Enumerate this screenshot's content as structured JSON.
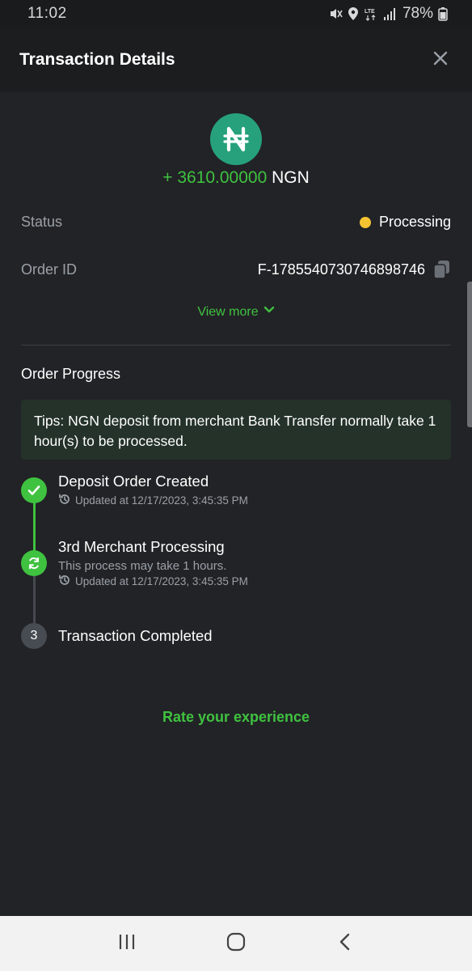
{
  "status_bar": {
    "time": "11:02",
    "battery": "78%"
  },
  "header": {
    "title": "Transaction Details"
  },
  "currency": {
    "icon": "naira-icon",
    "symbol": "₦",
    "amount": "+ 3610.00000",
    "code": "NGN",
    "brand_color": "#26a17b"
  },
  "details": {
    "status_label": "Status",
    "status_value": "Processing",
    "status_color": "#f5c431",
    "order_label": "Order ID",
    "order_value": "F-1785540730746898746",
    "view_more": "View more"
  },
  "progress": {
    "title": "Order Progress",
    "tips": "Tips: NGN deposit from merchant Bank Transfer normally take 1 hour(s) to be processed.",
    "steps": [
      {
        "title": "Deposit Order Created",
        "updated": "Updated at 12/17/2023, 3:45:35 PM",
        "state": "done"
      },
      {
        "title": "3rd Merchant Processing",
        "subtitle": "This process may take 1 hours.",
        "updated": "Updated at 12/17/2023, 3:45:35 PM",
        "state": "processing"
      },
      {
        "number": "3",
        "title": "Transaction Completed",
        "state": "pending"
      }
    ]
  },
  "rate_label": "Rate your experience",
  "accent_color": "#3fc240"
}
